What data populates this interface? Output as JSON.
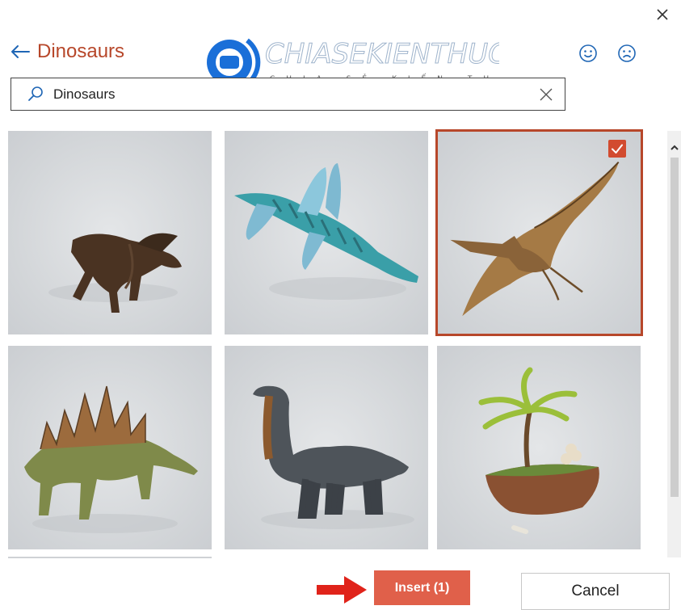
{
  "dialog": {
    "close_icon": "close-icon"
  },
  "header": {
    "back_icon": "arrow-left-icon",
    "title": "Dinosaurs",
    "feedback_positive_icon": "smiley-icon",
    "feedback_negative_icon": "frown-icon"
  },
  "watermark": {
    "brand": "CHIASEKIENTHUC",
    "tagline": "CHIA SẺ KIẾN THỨC"
  },
  "search": {
    "value": "Dinosaurs",
    "icon": "search-icon",
    "clear_icon": "close-icon"
  },
  "results": [
    {
      "subject": "parasaurolophus",
      "selected": false
    },
    {
      "subject": "plesiosaur",
      "selected": false
    },
    {
      "subject": "pterodactyl",
      "selected": true
    },
    {
      "subject": "stegosaurus",
      "selected": false
    },
    {
      "subject": "brachiosaurus",
      "selected": false
    },
    {
      "subject": "nest-island",
      "selected": false
    }
  ],
  "footer": {
    "insert_label": "Insert (1)",
    "cancel_label": "Cancel"
  },
  "colors": {
    "accent": "#b7472a",
    "insert_bg": "#e0604a",
    "checkbox": "#d24b2f"
  }
}
